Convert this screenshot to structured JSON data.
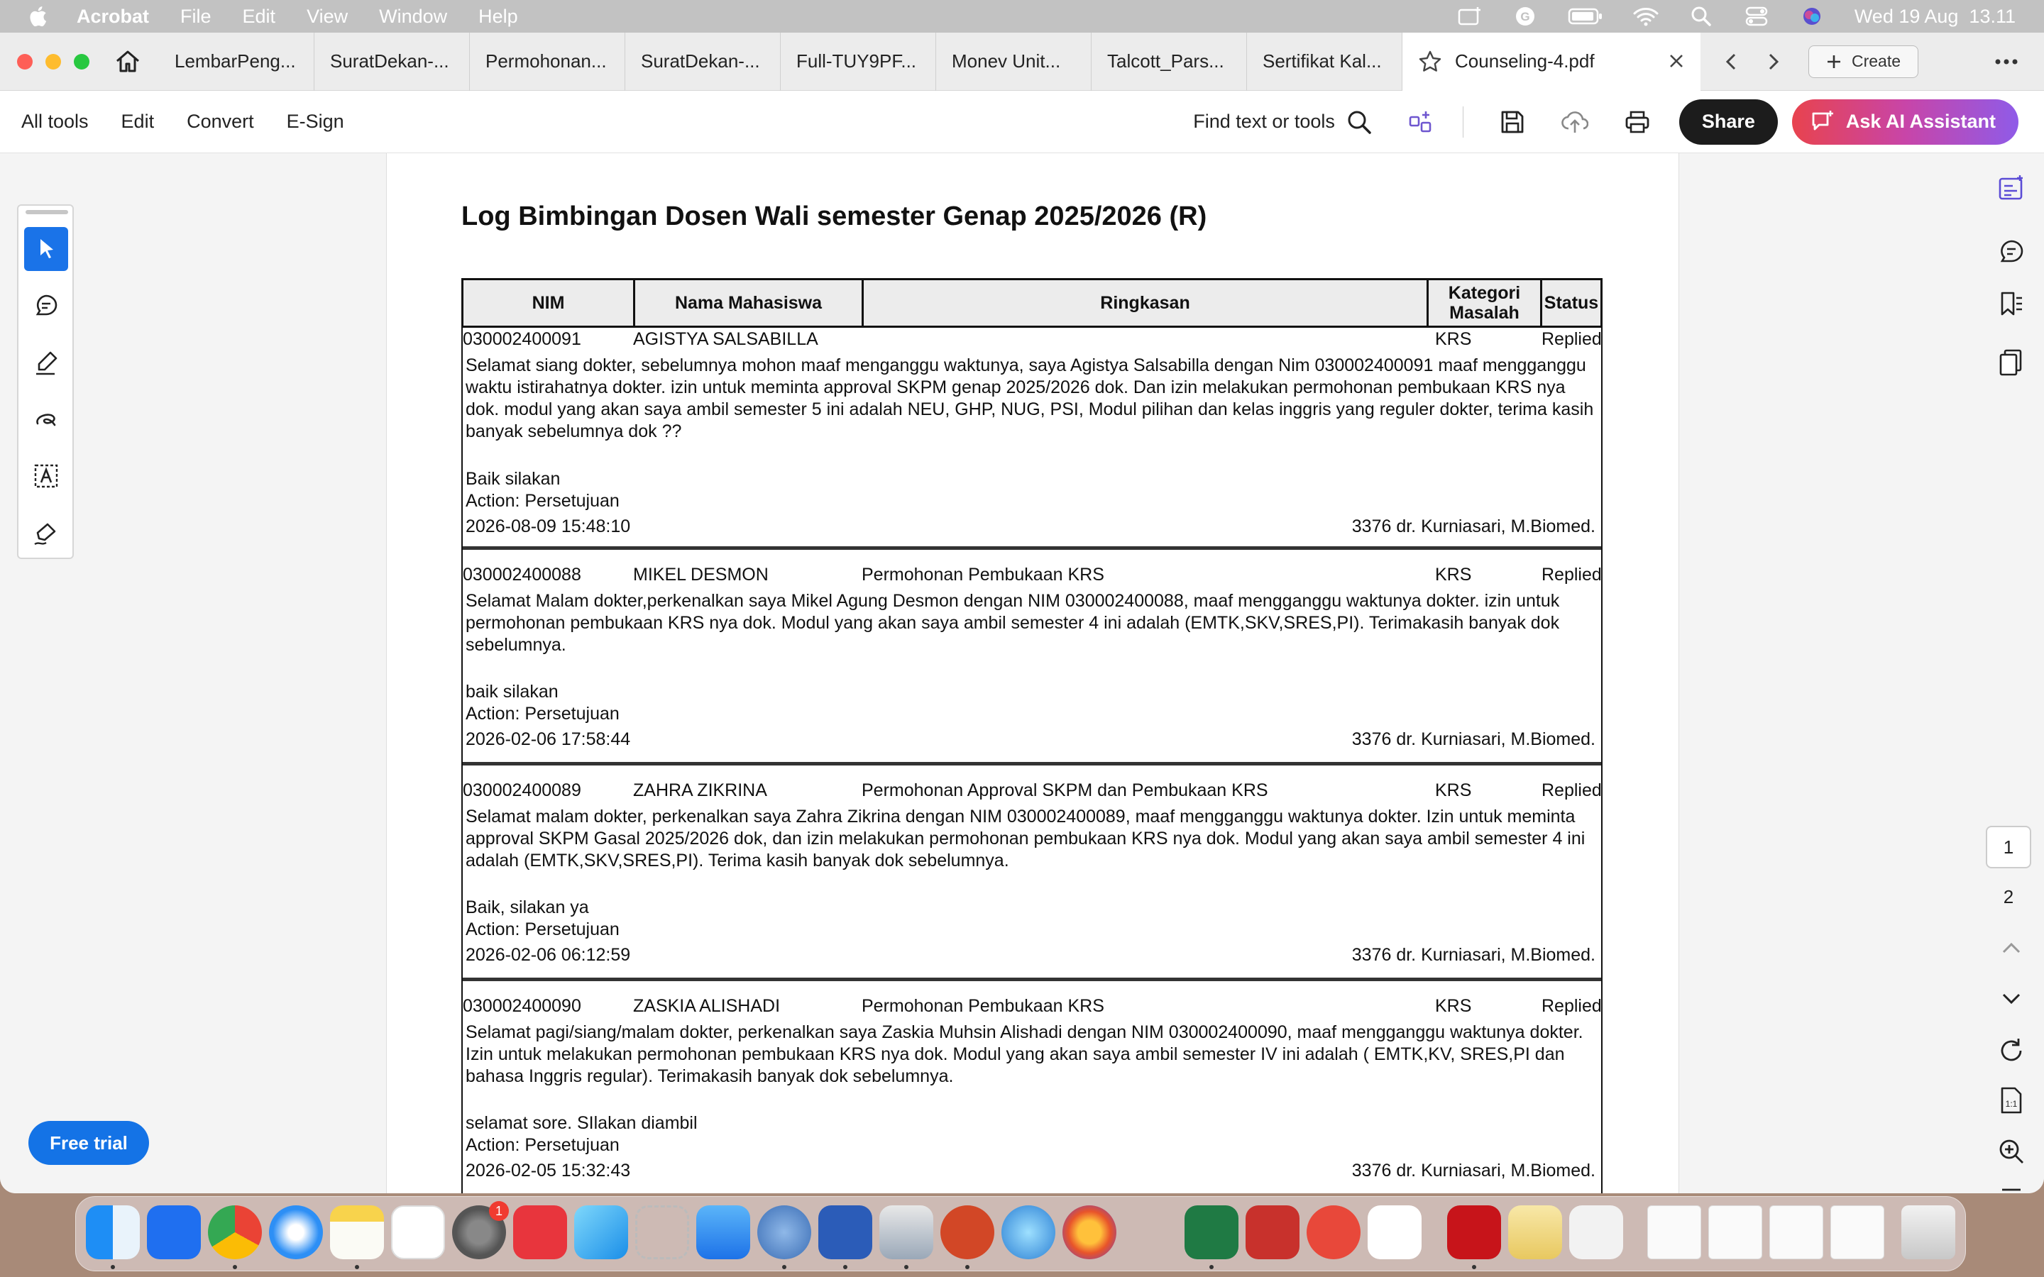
{
  "menubar": {
    "app": "Acrobat",
    "items": [
      "File",
      "Edit",
      "View",
      "Window",
      "Help"
    ],
    "clock": "Wed 19 Aug  13.11"
  },
  "tabs": [
    "LembarPeng...",
    "SuratDekan-...",
    "Permohonan...",
    "SuratDekan-...",
    "Full-TUY9PF...",
    "Monev Unit...",
    "Talcott_Pars...",
    "Sertifikat Kal..."
  ],
  "active_tab": "Counseling-4.pdf",
  "create_label": "Create",
  "toolbar": {
    "items": [
      "All tools",
      "Edit",
      "Convert",
      "E-Sign"
    ],
    "find": "Find text or tools",
    "share": "Share",
    "ai": "Ask AI Assistant"
  },
  "free_trial": "Free trial",
  "pages": [
    "1",
    "2"
  ],
  "doc": {
    "title": "Log Bimbingan Dosen Wali semester Genap 2025/2026 (R)",
    "headers": {
      "nim": "NIM",
      "nama": "Nama Mahasiswa",
      "ringkasan": "Ringkasan",
      "kategori": "Kategori Masalah",
      "status": "Status"
    },
    "entries": [
      {
        "nim": "030002400091",
        "nama": "AGISTYA SALSABILLA",
        "ringkasan": "",
        "kategori": "KRS",
        "status": "Replied",
        "message": "Selamat siang dokter, sebelumnya mohon maaf menganggu waktunya, saya Agistya Salsabilla dengan Nim 030002400091 maaf mengganggu waktu istirahatnya dokter. izin untuk meminta approval SKPM genap 2025/2026 dok. Dan izin melakukan permohonan pembukaan KRS nya dok. modul yang akan saya ambil semester 5 ini adalah NEU, GHP, NUG, PSI, Modul pilihan dan kelas inggris yang reguler dokter, terima kasih banyak sebelumnya dok ??",
        "reply": "Baik silakan",
        "action": "Action: Persetujuan",
        "datetime": "2026-08-09 15:48:10",
        "by": "3376 dr. Kurniasari, M.Biomed."
      },
      {
        "nim": "030002400088",
        "nama": "MIKEL DESMON",
        "ringkasan": "Permohonan Pembukaan KRS",
        "kategori": "KRS",
        "status": "Replied",
        "message": "Selamat Malam dokter,perkenalkan saya Mikel Agung Desmon dengan NIM 030002400088, maaf mengganggu waktunya dokter. izin untuk permohonan pembukaan KRS nya dok. Modul yang akan saya ambil semester 4 ini adalah (EMTK,SKV,SRES,PI). Terimakasih banyak dok sebelumnya.",
        "reply": "baik silakan",
        "action": "Action: Persetujuan",
        "datetime": "2026-02-06 17:58:44",
        "by": "3376 dr. Kurniasari, M.Biomed."
      },
      {
        "nim": "030002400089",
        "nama": "ZAHRA ZIKRINA",
        "ringkasan": "Permohonan Approval SKPM dan Pembukaan KRS",
        "kategori": "KRS",
        "status": "Replied",
        "message": "Selamat malam dokter, perkenalkan saya Zahra Zikrina dengan NIM 030002400089, maaf mengganggu waktunya dokter. Izin untuk meminta approval SKPM Gasal 2025/2026 dok, dan izin melakukan permohonan pembukaan KRS nya dok. Modul yang akan saya ambil semester 4 ini adalah (EMTK,SKV,SRES,PI). Terima kasih banyak dok sebelumnya.",
        "reply": "Baik, silakan ya",
        "action": "Action: Persetujuan",
        "datetime": "2026-02-06 06:12:59",
        "by": "3376 dr. Kurniasari, M.Biomed."
      },
      {
        "nim": "030002400090",
        "nama": "ZASKIA ALISHADI",
        "ringkasan": "Permohonan Pembukaan KRS",
        "kategori": "KRS",
        "status": "Replied",
        "message": "Selamat pagi/siang/malam dokter, perkenalkan saya Zaskia Muhsin Alishadi dengan NIM 030002400090, maaf mengganggu waktunya dokter. Izin untuk melakukan permohonan pembukaan KRS nya dok. Modul yang akan saya ambil semester IV ini adalah ( EMTK,KV, SRES,PI dan bahasa Inggris regular). Terimakasih banyak dok sebelumnya.",
        "reply": "selamat sore. SIlakan diambil",
        "action": "Action: Persetujuan",
        "datetime": "2026-02-05 15:32:43",
        "by": "3376 dr. Kurniasari, M.Biomed."
      }
    ]
  },
  "dock_badge": "1",
  "colors": {
    "accent": "#1a73e8",
    "share": "#1c1c1c",
    "free_trial": "#1473e6"
  }
}
